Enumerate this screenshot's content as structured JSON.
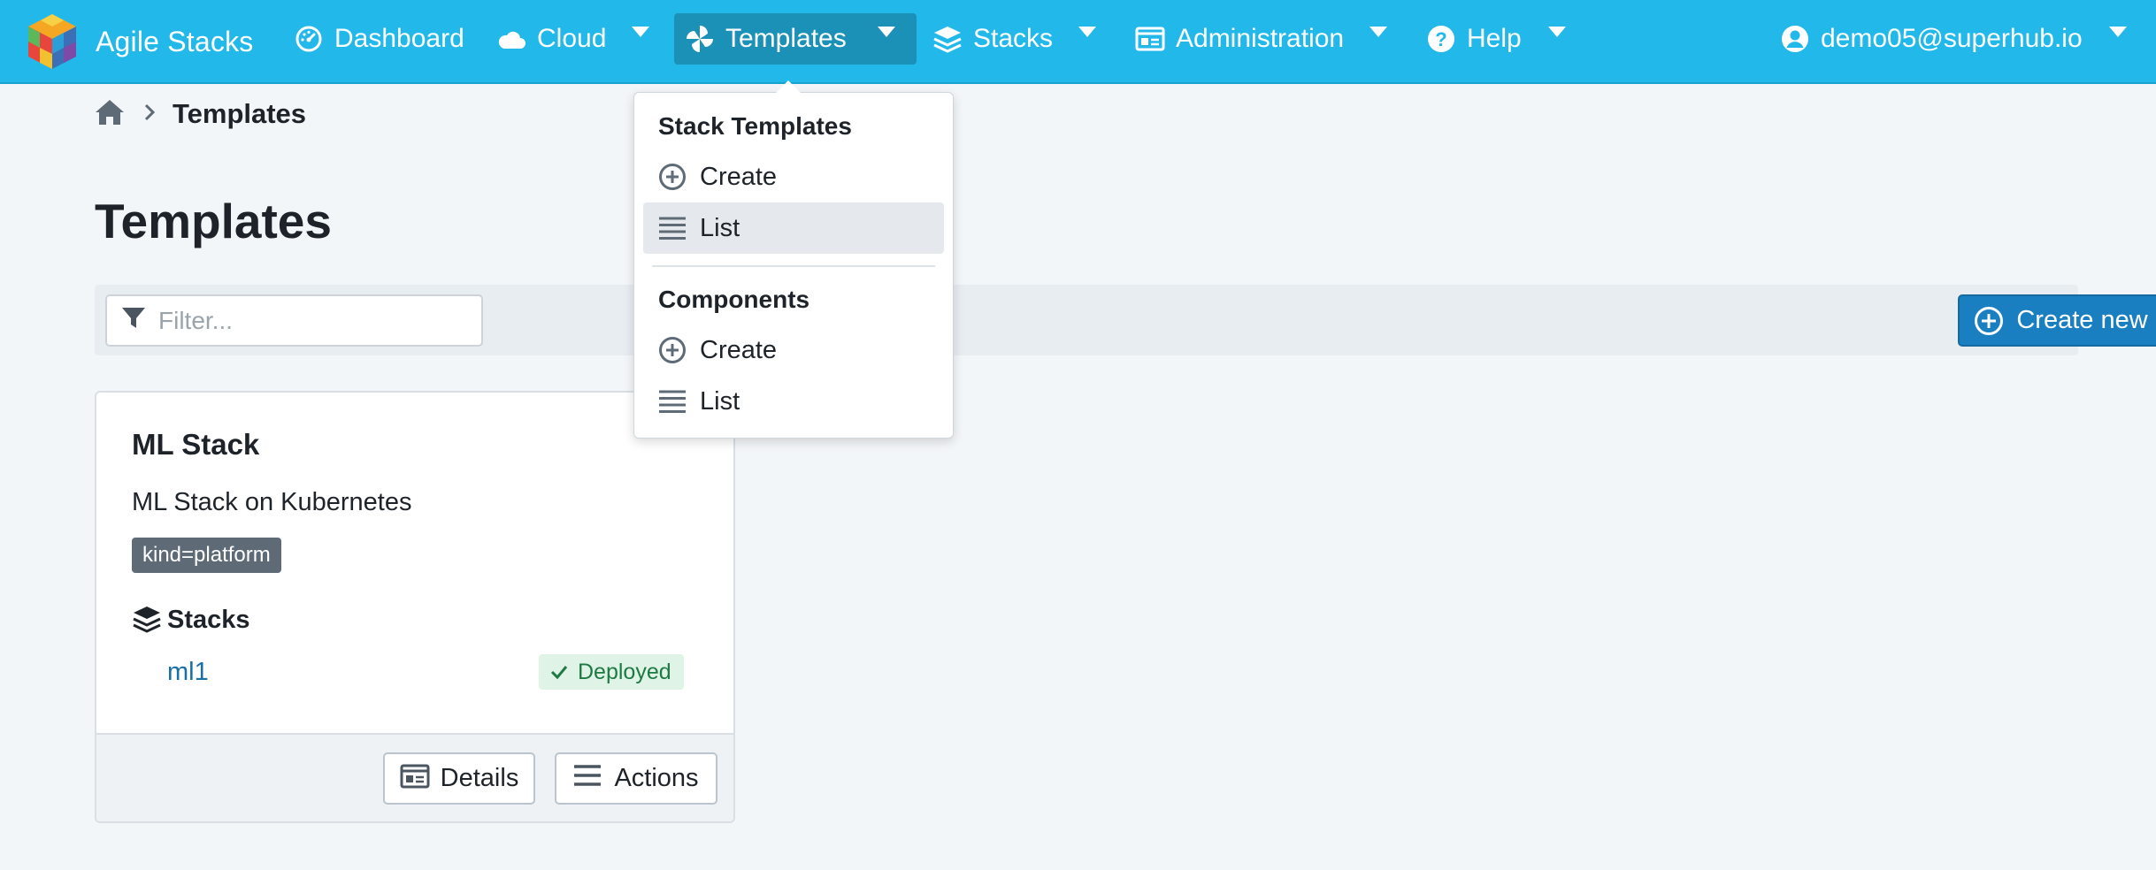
{
  "app": {
    "name": "Agile Stacks"
  },
  "nav": {
    "dashboard": "Dashboard",
    "cloud": "Cloud",
    "templates": "Templates",
    "stacks": "Stacks",
    "administration": "Administration",
    "help": "Help",
    "user": "demo05@superhub.io",
    "active": "Templates"
  },
  "dropdown": {
    "stack_templates_header": "Stack Templates",
    "stack_templates_create": "Create",
    "stack_templates_list": "List",
    "components_header": "Components",
    "components_create": "Create",
    "components_list": "List",
    "selected": "Stack Templates / List"
  },
  "breadcrumb": {
    "current": "Templates"
  },
  "page": {
    "title": "Templates"
  },
  "filter": {
    "placeholder": "Filter...",
    "value": ""
  },
  "toolbar": {
    "create_new_label": "Create new"
  },
  "cards": [
    {
      "title": "ML Stack",
      "description": "ML Stack on Kubernetes",
      "tag": "kind=platform",
      "stacks_label": "Stacks",
      "stacks": [
        {
          "name": "ml1",
          "status": "Deployed"
        }
      ],
      "details_label": "Details",
      "actions_label": "Actions"
    }
  ],
  "colors": {
    "topbar": "#22b9ea",
    "active_nav": "#1b91b8",
    "primary_button": "#1a7fc0",
    "link": "#1a6fa6",
    "tag": "#5e6b77",
    "deployed_bg": "#dff3e6",
    "deployed_text": "#1e7a43"
  }
}
